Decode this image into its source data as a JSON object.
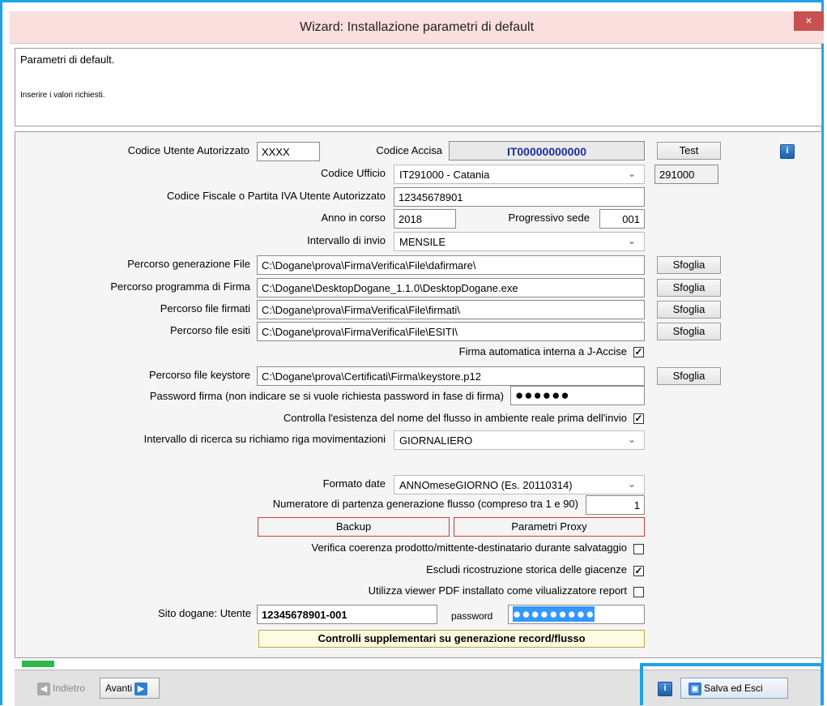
{
  "window": {
    "title": "Wizard: Installazione parametri di default",
    "close_icon": "×"
  },
  "header": {
    "title": "Parametri di default.",
    "subtitle": "Inserire i valori richiesti."
  },
  "form": {
    "codice_utente": {
      "label": "Codice Utente Autorizzato",
      "value": "XXXX"
    },
    "codice_accisa": {
      "label": "Codice Accisa",
      "value": "IT00000000000"
    },
    "test_button": "Test",
    "info_icon": "i",
    "codice_ufficio": {
      "label": "Codice Ufficio",
      "value": "IT291000 - Catania",
      "code": "291000"
    },
    "codice_fiscale": {
      "label": "Codice Fiscale o Partita IVA Utente Autorizzato",
      "value": "12345678901"
    },
    "anno": {
      "label": "Anno in corso",
      "value": "2018"
    },
    "progressivo": {
      "label": "Progressivo sede",
      "value": "001"
    },
    "intervallo_invio": {
      "label": "Intervallo di invio",
      "value": "MENSILE"
    },
    "percorso_generazione": {
      "label": "Percorso generazione File",
      "value": "C:\\Dogane\\prova\\FirmaVerifica\\File\\dafirmare\\"
    },
    "percorso_programma": {
      "label": "Percorso programma di Firma",
      "value": "C:\\Dogane\\DesktopDogane_1.1.0\\DesktopDogane.exe"
    },
    "percorso_firmati": {
      "label": "Percorso file firmati",
      "value": "C:\\Dogane\\prova\\FirmaVerifica\\File\\firmati\\"
    },
    "percorso_esiti": {
      "label": "Percorso file esiti",
      "value": "C:\\Dogane\\prova\\FirmaVerifica\\File\\ESITI\\"
    },
    "sfoglia_label": "Sfoglia",
    "firma_automatica": {
      "label": "Firma automatica interna a J-Accise",
      "checked": true
    },
    "percorso_keystore": {
      "label": "Percorso file keystore",
      "value": "C:\\Dogane\\prova\\Certificati\\Firma\\keystore.p12"
    },
    "password_firma": {
      "label": "Password firma (non indicare se si vuole richiesta password in fase di firma)",
      "masked": "●●●●●●"
    },
    "controlla_flusso": {
      "label": "Controlla l'esistenza del nome del flusso in ambiente reale prima dell'invio",
      "checked": true
    },
    "intervallo_ricerca": {
      "label": "Intervallo di ricerca su richiamo riga movimentazioni",
      "value": "GIORNALIERO"
    },
    "formato_date": {
      "label": "Formato date",
      "value": "ANNOmeseGIORNO (Es. 20110314)"
    },
    "numeratore": {
      "label": "Numeratore di partenza generazione flusso (compreso tra 1 e 90)",
      "value": "1"
    },
    "backup_button": "Backup",
    "proxy_button": "Parametri Proxy",
    "verifica_coerenza": {
      "label": "Verifica coerenza prodotto/mittente-destinatario durante salvataggio",
      "checked": false
    },
    "escludi_ricostruzione": {
      "label": "Escludi ricostruzione storica delle giacenze",
      "checked": true
    },
    "utilizza_viewer": {
      "label": "Utilizza viewer PDF installato come vilualizzatore report",
      "checked": false
    },
    "sito_dogane": {
      "label": "Sito dogane: Utente",
      "value": "12345678901-001",
      "password_label": "password",
      "password_masked": "●●●●●●●●●"
    },
    "controlli_button": "Controlli supplementari su generazione record/flusso"
  },
  "footer": {
    "indietro": "Indietro",
    "avanti": "Avanti",
    "salva": "Salva ed Esci",
    "progress": 0.04
  },
  "colors": {
    "accent": "#1ea1e6",
    "codice_accisa": "#1a2fa0",
    "progress": "#2eb84a"
  }
}
